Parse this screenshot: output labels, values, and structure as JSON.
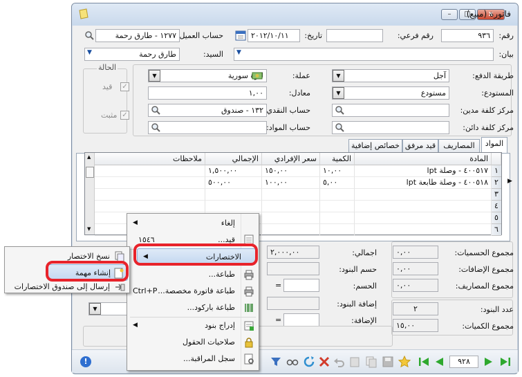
{
  "window": {
    "title": "فاتورة (مبيع)",
    "minimize_label": "–",
    "maximize_label": "□",
    "close_label": "x"
  },
  "header": {
    "number_label": "رقم:",
    "number_value": "٩٣٦",
    "sub_number_label": "رقم فرعي:",
    "sub_number_value": "",
    "date_label": "تاريخ:",
    "date_value": "٢٠١٢/١٠/١١",
    "customer_account_label": "حساب العميل:",
    "customer_account_value": "١٢٧٧ - طارق رحمة",
    "statement_label": "بيان:",
    "statement_value": "",
    "mister_label": "السيد:",
    "mister_value": "طارق رحمة"
  },
  "details": {
    "payment_method_label": "طريقة الدفع:",
    "payment_method_value": "آجل",
    "warehouse_label": "المستودع:",
    "warehouse_value": "مستودع",
    "debit_cost_center_label": "مركز كلفة مدين:",
    "credit_cost_center_label": "مركز كلفة دائن:",
    "currency_label": "عملة:",
    "currency_value": "ليرة سورية",
    "rate_label": "معادل:",
    "rate_value": "١,٠٠",
    "cash_account_label": "حساب النقدي:",
    "cash_account_value": "١٣٢ - صندوق",
    "materials_account_label": "حساب المواد:",
    "materials_account_value": ""
  },
  "status": {
    "title": "الحالة",
    "posted_label": "قيد",
    "fixed_label": "مثبت"
  },
  "tabs": [
    {
      "label": "المواد"
    },
    {
      "label": "المصاريف"
    },
    {
      "label": "قيد مرفق"
    },
    {
      "label": "خصائص إضافية"
    }
  ],
  "grid": {
    "columns": [
      "المادة",
      "الكمية",
      "سعر الإفرادي",
      "الإجمالي",
      "ملاحظات"
    ],
    "rows": [
      {
        "num": "١",
        "material": "٤٠٠٥١٧ - وصلة lpt",
        "qty": "١٠,٠٠",
        "price": "١٥٠,٠٠",
        "total": "١,٥٠٠,٠٠",
        "notes": ""
      },
      {
        "num": "٢",
        "material": "٤٠٠٥١٨ - وصلة طابعة lpt",
        "qty": "٥,٠٠",
        "price": "١٠٠,٠٠",
        "total": "٥٠٠,٠٠",
        "notes": ""
      },
      {
        "num": "٣",
        "material": "",
        "qty": "",
        "price": "",
        "total": "",
        "notes": ""
      },
      {
        "num": "٤",
        "material": "",
        "qty": "",
        "price": "",
        "total": "",
        "notes": ""
      },
      {
        "num": "٥",
        "material": "",
        "qty": "",
        "price": "",
        "total": "",
        "notes": ""
      },
      {
        "num": "٦",
        "material": "",
        "qty": "",
        "price": "",
        "total": "",
        "notes": ""
      }
    ]
  },
  "totals": {
    "discounts_total_label": "مجموع الحسميات:",
    "discounts_total_value": "٠,٠٠",
    "additions_total_label": "مجموع الإضافات:",
    "additions_total_value": "٠,٠٠",
    "expenses_total_label": "مجموع المصاريف:",
    "expenses_total_value": "٠,٠٠",
    "items_count_label": "عدد البنود:",
    "items_count_value": "٢",
    "quantities_total_label": "مجموع الكميات:",
    "quantities_total_value": "١٥,٠٠",
    "grand_total_label": "اجمالي:",
    "grand_total_value": "٢,٠٠٠,٠٠",
    "items_discount_label": "حسم البنود:",
    "discount_label": "الحسم:",
    "items_addition_label": "إضافة البنود:",
    "addition_label": "الإضافة:",
    "equals": "="
  },
  "context_menu": {
    "items": [
      {
        "label": "إلغاء",
        "shortcut": ""
      },
      {
        "label": "قيد...",
        "shortcut": "١٥٤٦"
      },
      {
        "label": "الاختصارات",
        "shortcut": ""
      },
      {
        "label": "طباعة...",
        "shortcut": ""
      },
      {
        "label": "طباعة فاتورة مخصصة...",
        "shortcut": "Ctrl+P"
      },
      {
        "label": "طباعة باركود...",
        "shortcut": ""
      },
      {
        "label": "إدراج بنود",
        "shortcut": ""
      },
      {
        "label": "صلاحيات الحقول",
        "shortcut": ""
      },
      {
        "label": "سجل المراقبة...",
        "shortcut": ""
      }
    ]
  },
  "submenu": {
    "items": [
      {
        "label": "نسخ الاختصار"
      },
      {
        "label": "إنشاء مهمة"
      },
      {
        "label": "إرسال إلى صندوق الاختصارات"
      }
    ]
  },
  "toolbar": {
    "record_number": "٩٢٨",
    "info_label": "!"
  },
  "colors": {
    "highlight": "#c3d7f0",
    "annotation_red": "#e8232b",
    "nav_green": "#2ea82e"
  }
}
